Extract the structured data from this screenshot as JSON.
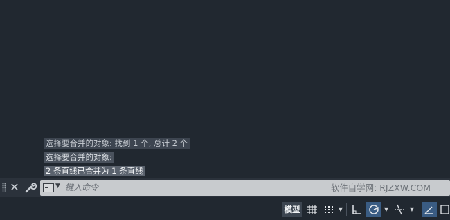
{
  "history": {
    "line1": "选择要合并的对象: 找到 1 个, 总计 2 个",
    "line2": "选择要合并的对象:",
    "line3": "2 条直线已合并为 1 条直线"
  },
  "command_line": {
    "placeholder": "键入命令",
    "close_icon": "close-icon",
    "customize_icon": "wrench-icon",
    "prompt_icon": "command-prompt-icon"
  },
  "watermark": "软件自学网: RJZXW.COM",
  "status_bar": {
    "model_label": "模型",
    "icons": [
      "grid-icon",
      "snap-icon",
      "ortho-icon",
      "polar-tracking-icon",
      "object-snap-tracking-icon",
      "isometric-drafting-icon"
    ]
  },
  "colors": {
    "background": "#212830",
    "command_input": "#c8cbce",
    "active_toggle": "#3a5c83"
  }
}
